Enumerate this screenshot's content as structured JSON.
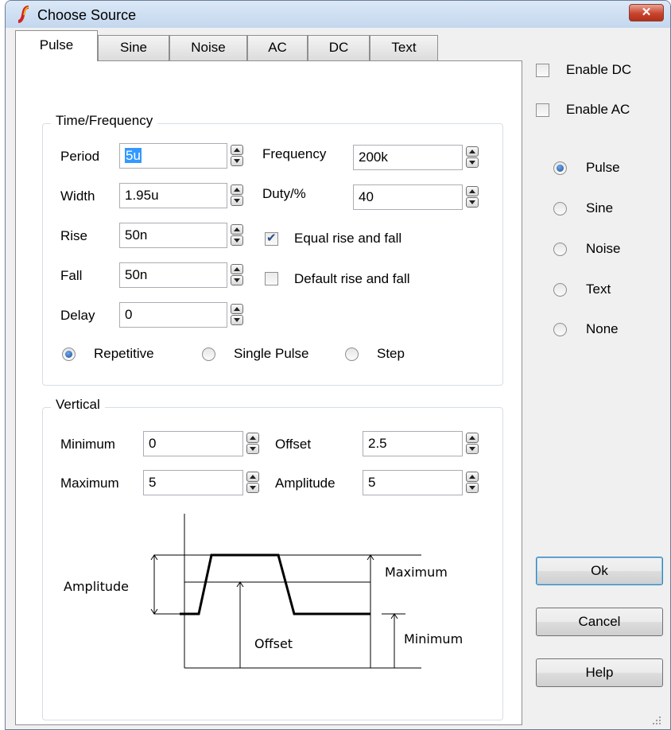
{
  "window": {
    "title": "Choose Source",
    "close_label": "✕"
  },
  "tabs": [
    {
      "label": "Pulse",
      "active": true
    },
    {
      "label": "Sine",
      "active": false
    },
    {
      "label": "Noise",
      "active": false
    },
    {
      "label": "AC",
      "active": false
    },
    {
      "label": "DC",
      "active": false
    },
    {
      "label": "Text",
      "active": false
    }
  ],
  "time_frequency": {
    "group_label": "Time/Frequency",
    "period": {
      "label": "Period",
      "value": "5u"
    },
    "width": {
      "label": "Width",
      "value": "1.95u"
    },
    "rise": {
      "label": "Rise",
      "value": "50n"
    },
    "fall": {
      "label": "Fall",
      "value": "50n"
    },
    "delay": {
      "label": "Delay",
      "value": "0"
    },
    "frequency": {
      "label": "Frequency",
      "value": "200k"
    },
    "duty": {
      "label": "Duty/%",
      "value": "40"
    },
    "equal_rise_fall": {
      "label": "Equal rise and fall",
      "checked": true
    },
    "default_rise_fall": {
      "label": "Default rise and fall",
      "checked": false
    },
    "mode_options": [
      {
        "label": "Repetitive",
        "selected": true
      },
      {
        "label": "Single Pulse",
        "selected": false
      },
      {
        "label": "Step",
        "selected": false
      }
    ]
  },
  "vertical": {
    "group_label": "Vertical",
    "minimum": {
      "label": "Minimum",
      "value": "0"
    },
    "maximum": {
      "label": "Maximum",
      "value": "5"
    },
    "offset": {
      "label": "Offset",
      "value": "2.5"
    },
    "amplitude": {
      "label": "Amplitude",
      "value": "5"
    }
  },
  "diagram": {
    "amplitude_label": "Amplitude",
    "maximum_label": "Maximum",
    "offset_label": "Offset",
    "minimum_label": "Minimum"
  },
  "right_panel": {
    "enable_dc": {
      "label": "Enable DC",
      "checked": false
    },
    "enable_ac": {
      "label": "Enable AC",
      "checked": false
    },
    "source_types": [
      {
        "label": "Pulse",
        "selected": true
      },
      {
        "label": "Sine",
        "selected": false
      },
      {
        "label": "Noise",
        "selected": false
      },
      {
        "label": "Text",
        "selected": false
      },
      {
        "label": "None",
        "selected": false
      }
    ]
  },
  "buttons": {
    "ok": "Ok",
    "cancel": "Cancel",
    "help": "Help"
  },
  "colors": {
    "accent": "#3399ff",
    "title_bar": "#c4d7ee",
    "close_button": "#c8442d"
  }
}
